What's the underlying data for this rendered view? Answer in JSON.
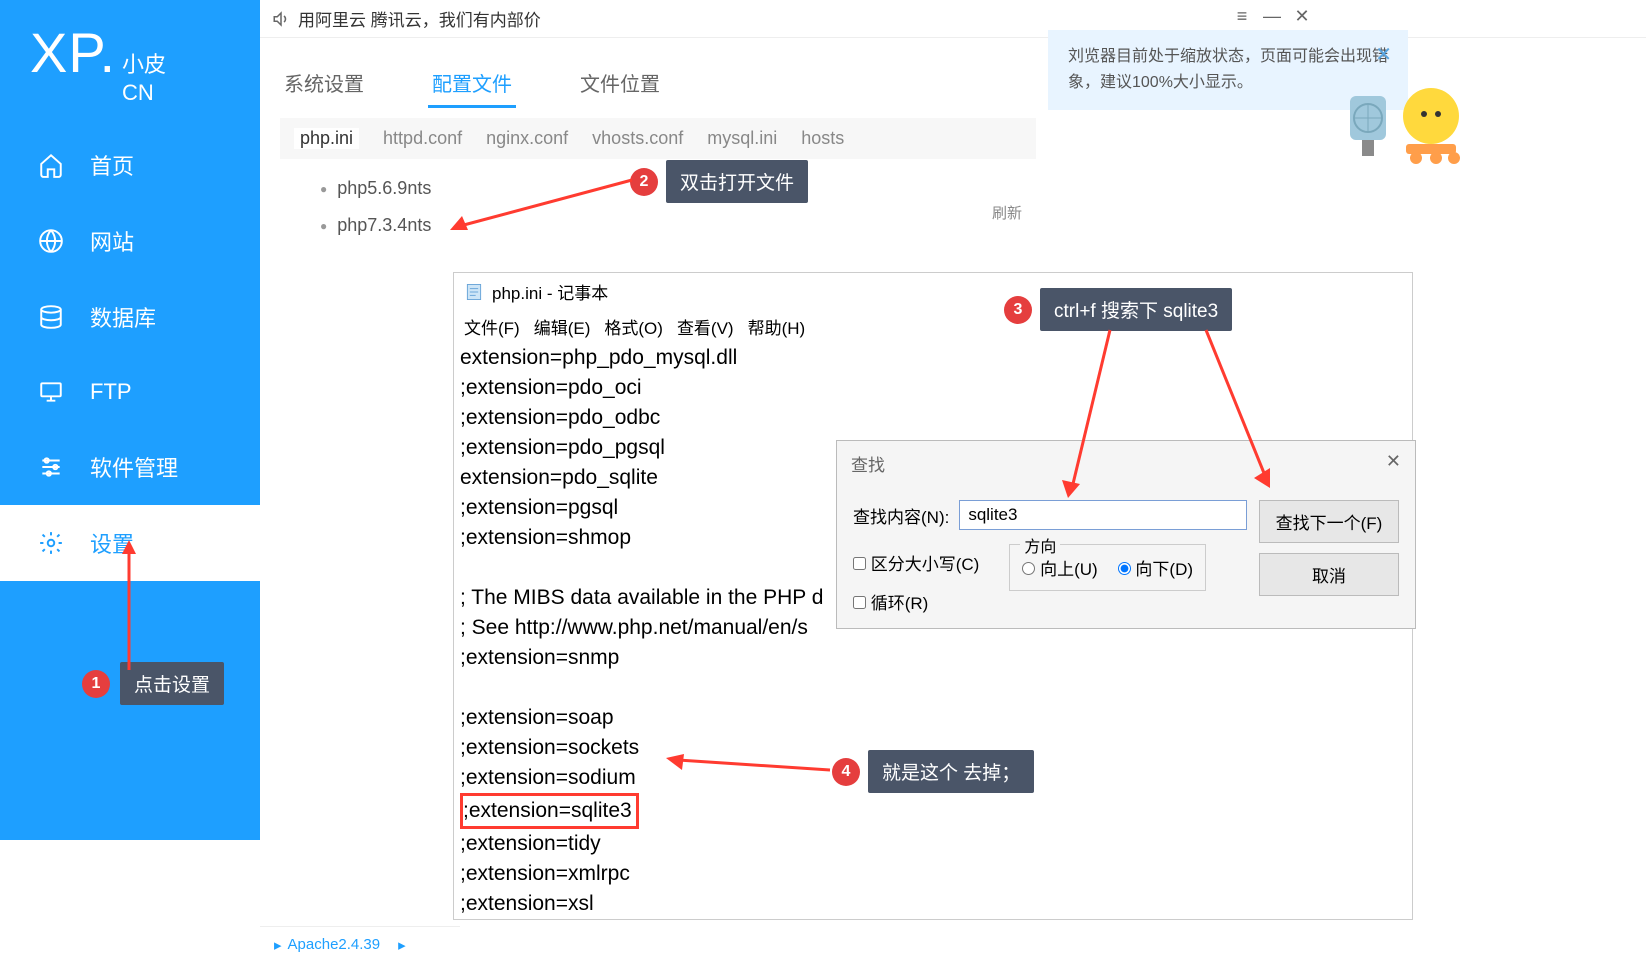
{
  "logo": {
    "brand": "XP.",
    "sub1": "小皮",
    "sub2": "CN"
  },
  "announcement": "用阿里云 腾讯云，我们有内部价",
  "nav": [
    {
      "label": "首页"
    },
    {
      "label": "网站"
    },
    {
      "label": "数据库"
    },
    {
      "label": "FTP"
    },
    {
      "label": "软件管理"
    },
    {
      "label": "设置"
    }
  ],
  "tabs": {
    "t0": "系统设置",
    "t1": "配置文件",
    "t2": "文件位置"
  },
  "subtabs": {
    "s0": "php.ini",
    "s1": "httpd.conf",
    "s2": "nginx.conf",
    "s3": "vhosts.conf",
    "s4": "mysql.ini",
    "s5": "hosts"
  },
  "php_versions": {
    "v0": "php5.6.9nts",
    "v1": "php7.3.4nts"
  },
  "refresh": "刷新",
  "bottom_service": "Apache2.4.39",
  "zoom_notice": {
    "line": "刘览器目前处于缩放状态，页面可能会出现错象，建议100%大小显示。"
  },
  "notepad": {
    "title": "php.ini - 记事本",
    "menu": {
      "m0": "文件(F)",
      "m1": "编辑(E)",
      "m2": "格式(O)",
      "m3": "查看(V)",
      "m4": "帮助(H)"
    },
    "lines": {
      "l0": "extension=php_pdo_mysql.dll",
      "l1": ";extension=pdo_oci",
      "l2": ";extension=pdo_odbc",
      "l3": ";extension=pdo_pgsql",
      "l4": "extension=pdo_sqlite",
      "l5": ";extension=pgsql",
      "l6": ";extension=shmop",
      "l7": "",
      "l8": "; The MIBS data available in the PHP d",
      "l9": "; See http://www.php.net/manual/en/s",
      "l10": ";extension=snmp",
      "l11": "",
      "l12": ";extension=soap",
      "l13": ";extension=sockets",
      "l14": ";extension=sodium",
      "l15": ";extension=sqlite3",
      "l16": ";extension=tidy",
      "l17": ";extension=xmlrpc",
      "l18": ";extension=xsl"
    }
  },
  "find": {
    "title": "查找",
    "label": "查找内容(N):",
    "value": "sqlite3",
    "case": "区分大小写(C)",
    "loop": "循环(R)",
    "dir": "方向",
    "up": "向上(U)",
    "down": "向下(D)",
    "next": "查找下一个(F)",
    "cancel": "取消"
  },
  "callouts": {
    "c1": "点击设置",
    "c2": "双击打开文件",
    "c3": "ctrl+f  搜索下 sqlite3",
    "c4": "就是这个 去掉；"
  },
  "badges": {
    "b1": "1",
    "b2": "2",
    "b3": "3",
    "b4": "4"
  }
}
